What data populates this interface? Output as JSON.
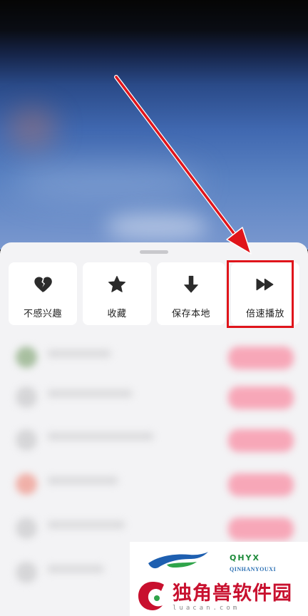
{
  "actions": [
    {
      "label": "不感兴趣",
      "icon": "broken-heart-icon"
    },
    {
      "label": "收藏",
      "icon": "star-icon"
    },
    {
      "label": "保存本地",
      "icon": "download-arrow-icon"
    },
    {
      "label": "倍速播放",
      "icon": "fast-forward-icon"
    }
  ],
  "colors": {
    "sheet_bg": "#f3f3f5",
    "card_bg": "#ffffff",
    "icon": "#2b2b2b",
    "annotation_red": "#e0151b"
  },
  "watermark": {
    "brand": "QHYX",
    "subtitle": "QINHANYOUXI",
    "main_text": "独角兽软件园",
    "url": "luacan.com"
  }
}
